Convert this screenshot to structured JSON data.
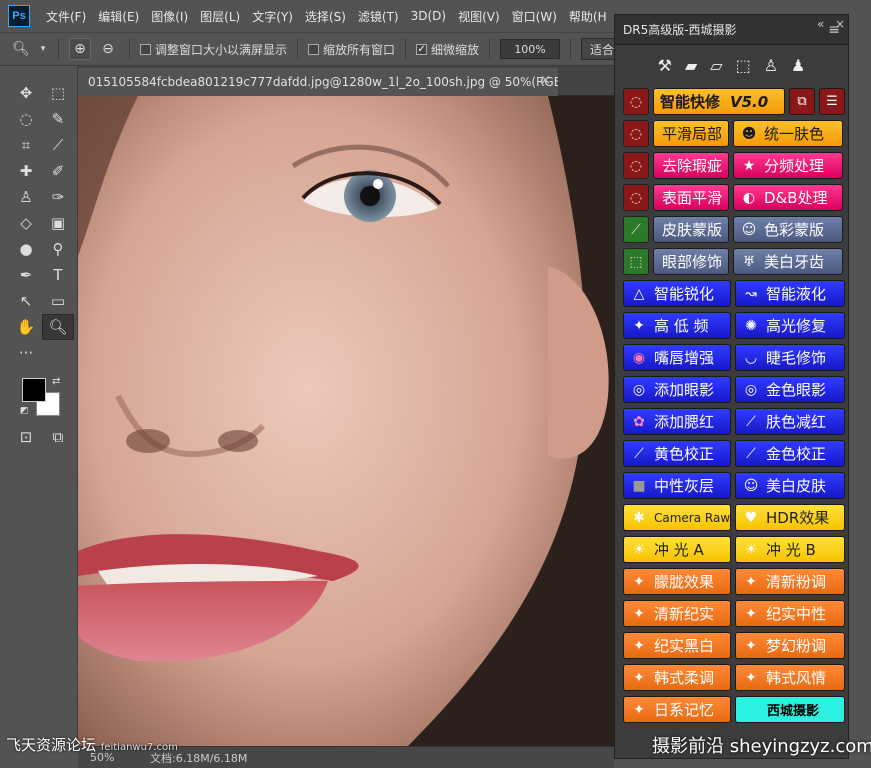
{
  "app": {
    "logo": "Ps"
  },
  "menu": [
    "文件(F)",
    "编辑(E)",
    "图像(I)",
    "图层(L)",
    "文字(Y)",
    "选择(S)",
    "滤镜(T)",
    "3D(D)",
    "视图(V)",
    "窗口(W)",
    "帮助(H"
  ],
  "options": {
    "fit_window": "调整窗口大小以满屏显示",
    "zoom_all": "缩放所有窗口",
    "scrubby": "细微缩放",
    "zoom_value": "100%",
    "fit_screen": "适合屏幕"
  },
  "document": {
    "tab_title": "015105584fcbdea801219c777dafdd.jpg@1280w_1l_2o_100sh.jpg @ 50%(RGB/8)",
    "close": "×"
  },
  "status": {
    "zoom": "50%",
    "doc_size": "文档:6.18M/6.18M"
  },
  "panel": {
    "title": "DR5高级版-西城摄影",
    "icon_row": [
      "brush-icon",
      "bandage-icon",
      "healing-icon",
      "select-icon",
      "stamp-icon",
      "clone-icon"
    ],
    "rows": [
      {
        "left": "智能快修",
        "left_extra": "V5.0",
        "right_icons": [
          "layers-icon",
          "sliders-icon"
        ]
      },
      {
        "left": "平滑局部",
        "right": "统一肤色"
      },
      {
        "left": "去除瑕疵",
        "right": "分频处理"
      },
      {
        "left": "表面平滑",
        "right": "D&B处理"
      },
      {
        "left": "皮肤蒙版",
        "right": "色彩蒙版"
      },
      {
        "left": "眼部修饰",
        "right": "美白牙齿"
      },
      {
        "left": "智能锐化",
        "right": "智能液化"
      },
      {
        "left": "高 低 频",
        "right": "高光修复"
      },
      {
        "left": "嘴唇增强",
        "right": "睫毛修饰"
      },
      {
        "left": "添加眼影",
        "right": "金色眼影"
      },
      {
        "left": "添加腮红",
        "right": "肤色减红"
      },
      {
        "left": "黄色校正",
        "right": "金色校正"
      },
      {
        "left": "中性灰层",
        "right": "美白皮肤"
      },
      {
        "left": "Camera Raw",
        "right": "HDR效果"
      },
      {
        "left": "冲 光 A",
        "right": "冲 光 B"
      },
      {
        "left": "朦胧效果",
        "right": "清新粉调"
      },
      {
        "left": "清新纪实",
        "right": "纪实中性"
      },
      {
        "left": "纪实黑白",
        "right": "梦幻粉调"
      },
      {
        "left": "韩式柔调",
        "right": "韩式风情"
      },
      {
        "left": "日系记忆",
        "right": "西城摄影"
      }
    ]
  },
  "watermarks": {
    "left": "飞天资源论坛",
    "left_small": "feitianwu7.com",
    "right": "摄影前沿 sheyingzyz.com"
  }
}
